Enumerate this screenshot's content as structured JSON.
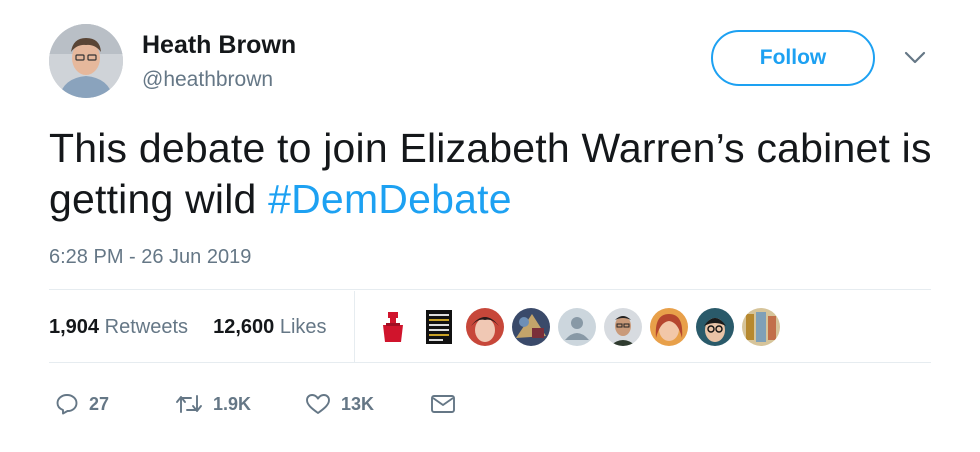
{
  "user": {
    "name": "Heath Brown",
    "handle": "@heathbrown",
    "avatar_icon": "profile-photo"
  },
  "follow_label": "Follow",
  "tweet": {
    "text": "This debate to join Elizabeth Warren’s cabinet is getting wild ",
    "hashtag": "#DemDebate"
  },
  "timestamp": "6:28 PM - 26 Jun 2019",
  "stats": {
    "retweets_count": "1,904",
    "retweets_label": "Retweets",
    "likes_count": "12,600",
    "likes_label": "Likes"
  },
  "actions": {
    "reply_count": "27",
    "retweet_count": "1.9K",
    "like_count": "13K"
  },
  "likers": [
    "liker-1",
    "liker-2",
    "liker-3",
    "liker-4",
    "liker-5",
    "liker-6",
    "liker-7",
    "liker-8",
    "liker-9"
  ],
  "colors": {
    "accent": "#1da1f2",
    "secondary_text": "#657786",
    "divider": "#e6ecf0"
  }
}
